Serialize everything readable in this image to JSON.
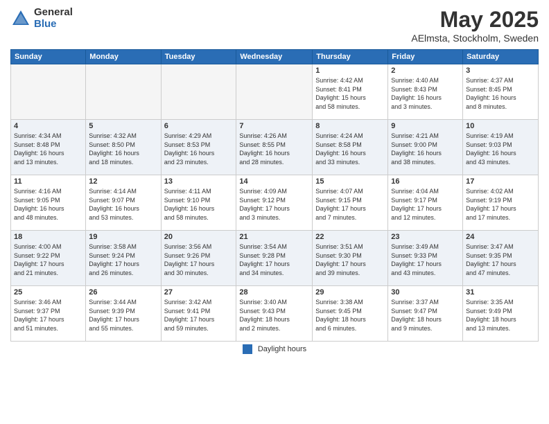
{
  "header": {
    "logo_general": "General",
    "logo_blue": "Blue",
    "title": "May 2025",
    "location": "AElmsta, Stockholm, Sweden"
  },
  "calendar": {
    "days_of_week": [
      "Sunday",
      "Monday",
      "Tuesday",
      "Wednesday",
      "Thursday",
      "Friday",
      "Saturday"
    ],
    "weeks": [
      [
        {
          "day": "",
          "info": ""
        },
        {
          "day": "",
          "info": ""
        },
        {
          "day": "",
          "info": ""
        },
        {
          "day": "",
          "info": ""
        },
        {
          "day": "1",
          "info": "Sunrise: 4:42 AM\nSunset: 8:41 PM\nDaylight: 15 hours\nand 58 minutes."
        },
        {
          "day": "2",
          "info": "Sunrise: 4:40 AM\nSunset: 8:43 PM\nDaylight: 16 hours\nand 3 minutes."
        },
        {
          "day": "3",
          "info": "Sunrise: 4:37 AM\nSunset: 8:45 PM\nDaylight: 16 hours\nand 8 minutes."
        }
      ],
      [
        {
          "day": "4",
          "info": "Sunrise: 4:34 AM\nSunset: 8:48 PM\nDaylight: 16 hours\nand 13 minutes."
        },
        {
          "day": "5",
          "info": "Sunrise: 4:32 AM\nSunset: 8:50 PM\nDaylight: 16 hours\nand 18 minutes."
        },
        {
          "day": "6",
          "info": "Sunrise: 4:29 AM\nSunset: 8:53 PM\nDaylight: 16 hours\nand 23 minutes."
        },
        {
          "day": "7",
          "info": "Sunrise: 4:26 AM\nSunset: 8:55 PM\nDaylight: 16 hours\nand 28 minutes."
        },
        {
          "day": "8",
          "info": "Sunrise: 4:24 AM\nSunset: 8:58 PM\nDaylight: 16 hours\nand 33 minutes."
        },
        {
          "day": "9",
          "info": "Sunrise: 4:21 AM\nSunset: 9:00 PM\nDaylight: 16 hours\nand 38 minutes."
        },
        {
          "day": "10",
          "info": "Sunrise: 4:19 AM\nSunset: 9:03 PM\nDaylight: 16 hours\nand 43 minutes."
        }
      ],
      [
        {
          "day": "11",
          "info": "Sunrise: 4:16 AM\nSunset: 9:05 PM\nDaylight: 16 hours\nand 48 minutes."
        },
        {
          "day": "12",
          "info": "Sunrise: 4:14 AM\nSunset: 9:07 PM\nDaylight: 16 hours\nand 53 minutes."
        },
        {
          "day": "13",
          "info": "Sunrise: 4:11 AM\nSunset: 9:10 PM\nDaylight: 16 hours\nand 58 minutes."
        },
        {
          "day": "14",
          "info": "Sunrise: 4:09 AM\nSunset: 9:12 PM\nDaylight: 17 hours\nand 3 minutes."
        },
        {
          "day": "15",
          "info": "Sunrise: 4:07 AM\nSunset: 9:15 PM\nDaylight: 17 hours\nand 7 minutes."
        },
        {
          "day": "16",
          "info": "Sunrise: 4:04 AM\nSunset: 9:17 PM\nDaylight: 17 hours\nand 12 minutes."
        },
        {
          "day": "17",
          "info": "Sunrise: 4:02 AM\nSunset: 9:19 PM\nDaylight: 17 hours\nand 17 minutes."
        }
      ],
      [
        {
          "day": "18",
          "info": "Sunrise: 4:00 AM\nSunset: 9:22 PM\nDaylight: 17 hours\nand 21 minutes."
        },
        {
          "day": "19",
          "info": "Sunrise: 3:58 AM\nSunset: 9:24 PM\nDaylight: 17 hours\nand 26 minutes."
        },
        {
          "day": "20",
          "info": "Sunrise: 3:56 AM\nSunset: 9:26 PM\nDaylight: 17 hours\nand 30 minutes."
        },
        {
          "day": "21",
          "info": "Sunrise: 3:54 AM\nSunset: 9:28 PM\nDaylight: 17 hours\nand 34 minutes."
        },
        {
          "day": "22",
          "info": "Sunrise: 3:51 AM\nSunset: 9:30 PM\nDaylight: 17 hours\nand 39 minutes."
        },
        {
          "day": "23",
          "info": "Sunrise: 3:49 AM\nSunset: 9:33 PM\nDaylight: 17 hours\nand 43 minutes."
        },
        {
          "day": "24",
          "info": "Sunrise: 3:47 AM\nSunset: 9:35 PM\nDaylight: 17 hours\nand 47 minutes."
        }
      ],
      [
        {
          "day": "25",
          "info": "Sunrise: 3:46 AM\nSunset: 9:37 PM\nDaylight: 17 hours\nand 51 minutes."
        },
        {
          "day": "26",
          "info": "Sunrise: 3:44 AM\nSunset: 9:39 PM\nDaylight: 17 hours\nand 55 minutes."
        },
        {
          "day": "27",
          "info": "Sunrise: 3:42 AM\nSunset: 9:41 PM\nDaylight: 17 hours\nand 59 minutes."
        },
        {
          "day": "28",
          "info": "Sunrise: 3:40 AM\nSunset: 9:43 PM\nDaylight: 18 hours\nand 2 minutes."
        },
        {
          "day": "29",
          "info": "Sunrise: 3:38 AM\nSunset: 9:45 PM\nDaylight: 18 hours\nand 6 minutes."
        },
        {
          "day": "30",
          "info": "Sunrise: 3:37 AM\nSunset: 9:47 PM\nDaylight: 18 hours\nand 9 minutes."
        },
        {
          "day": "31",
          "info": "Sunrise: 3:35 AM\nSunset: 9:49 PM\nDaylight: 18 hours\nand 13 minutes."
        }
      ]
    ]
  },
  "footer": {
    "legend_label": "Daylight hours"
  }
}
